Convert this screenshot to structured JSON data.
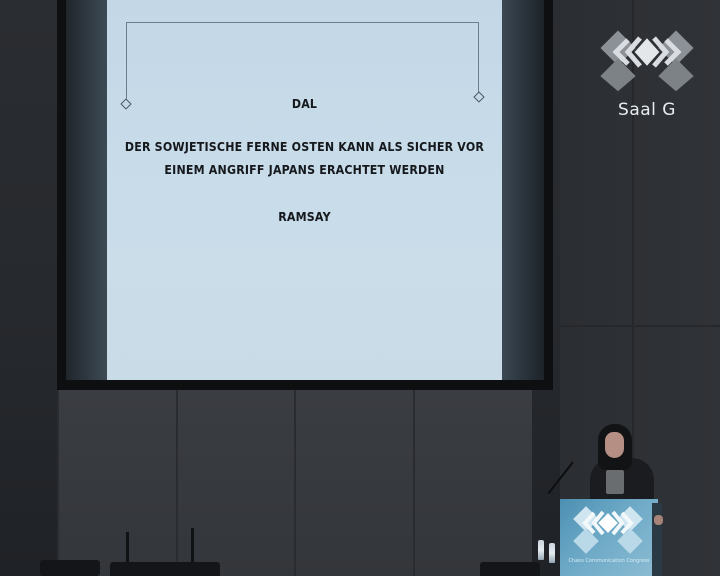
{
  "slide": {
    "lines": [
      "DAL",
      "DER SOWJETISCHE FERNE OSTEN KANN ALS SICHER VOR",
      "EINEM ANGRIFF JAPANS ERACHTET WERDEN",
      "RAMSAY"
    ]
  },
  "overlay": {
    "room_label": "Saal G",
    "logo_icon": "congress-logo-icon"
  },
  "podium": {
    "caption": "Chaos Communication Congress"
  },
  "colors": {
    "screen": "#c7dbe9",
    "slide_text": "#15181c",
    "podium": "#6aa7c5",
    "background": "#2a2d31"
  }
}
